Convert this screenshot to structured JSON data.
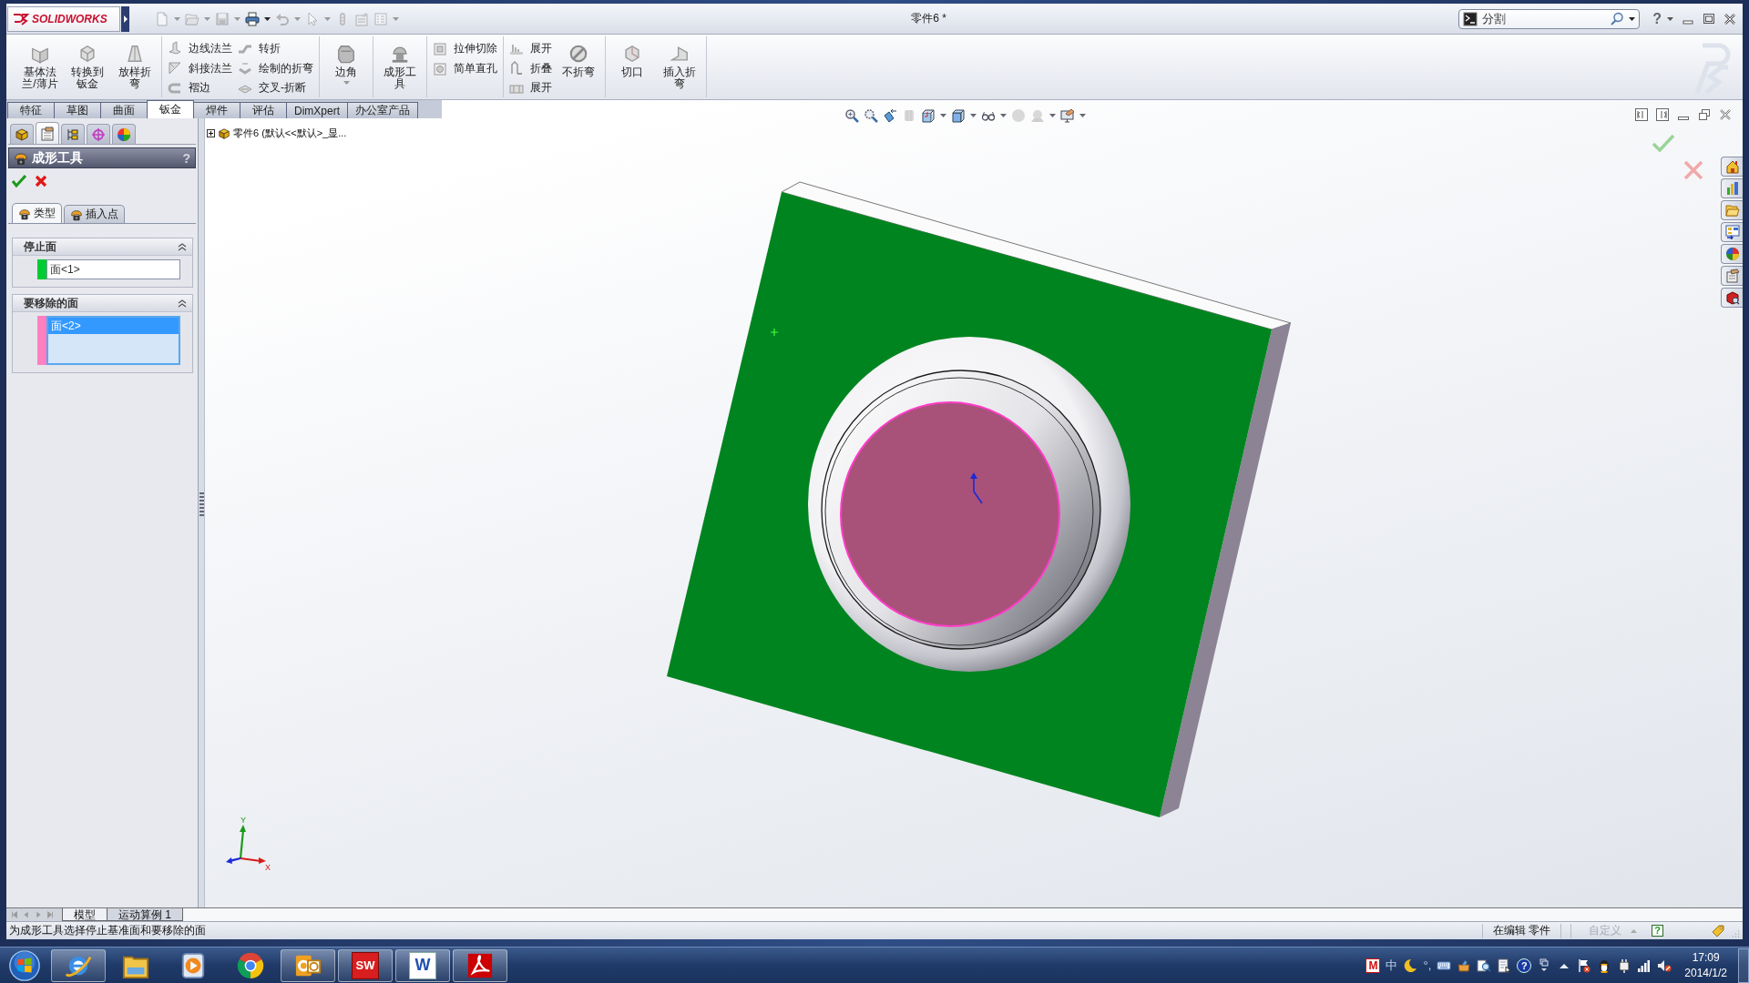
{
  "window": {
    "brand": "SOLIDWORKS",
    "title": "零件6 *",
    "search": {
      "value": "分割"
    },
    "help": "?"
  },
  "quick_access": [
    {
      "kind": "new",
      "menu": true,
      "disabled": true
    },
    {
      "kind": "open",
      "menu": true,
      "disabled": true
    },
    {
      "kind": "save",
      "menu": true,
      "disabled": true
    },
    {
      "kind": "print",
      "menu": true,
      "disabled": false
    },
    {
      "kind": "undo",
      "menu": true,
      "disabled": true
    },
    {
      "kind": "select",
      "menu": true,
      "disabled": true
    },
    {
      "kind": "rebuild",
      "menu": false,
      "disabled": true
    },
    {
      "kind": "properties",
      "menu": false,
      "disabled": true
    },
    {
      "kind": "options",
      "menu": true,
      "disabled": true
    }
  ],
  "ribbon": [
    [
      {
        "kind": "large",
        "label": "基体法兰/薄片",
        "menu": false
      },
      {
        "kind": "large",
        "label": "转换到钣金",
        "menu": false
      },
      {
        "kind": "large",
        "label": "放样折弯",
        "menu": false
      }
    ],
    [
      {
        "kind": "stack",
        "items": [
          {
            "label": "边线法兰"
          },
          {
            "label": "斜接法兰"
          },
          {
            "label": "褶边"
          }
        ]
      },
      {
        "kind": "stack",
        "items": [
          {
            "label": "转折"
          },
          {
            "label": "绘制的折弯"
          },
          {
            "label": "交叉-折断"
          }
        ]
      }
    ],
    [
      {
        "kind": "large",
        "label": "边角",
        "menu": true
      }
    ],
    [
      {
        "kind": "large",
        "label": "成形工具",
        "menu": false
      }
    ],
    [
      {
        "kind": "stack",
        "items": [
          {
            "label": "拉伸切除"
          },
          {
            "label": "简单直孔"
          }
        ]
      }
    ],
    [
      {
        "kind": "stack",
        "items": [
          {
            "label": "展开"
          },
          {
            "label": "折叠"
          },
          {
            "label": "展开"
          }
        ]
      },
      {
        "kind": "large",
        "label": "不折弯",
        "menu": false
      }
    ],
    [
      {
        "kind": "large",
        "label": "切口",
        "menu": false
      },
      {
        "kind": "large",
        "label": "插入折弯",
        "menu": false
      }
    ]
  ],
  "command_tabs": [
    {
      "label": "特征",
      "selected": false
    },
    {
      "label": "草图",
      "selected": false
    },
    {
      "label": "曲面",
      "selected": false
    },
    {
      "label": "钣金",
      "selected": true
    },
    {
      "label": "焊件",
      "selected": false
    },
    {
      "label": "评估",
      "selected": false
    },
    {
      "label": "DimXpert",
      "selected": false
    },
    {
      "label": "办公室产品",
      "selected": false
    }
  ],
  "manager_tabs": [
    {
      "kind": "feature-tree",
      "selected": false
    },
    {
      "kind": "property",
      "selected": true
    },
    {
      "kind": "configuration",
      "selected": false
    },
    {
      "kind": "dimxpert",
      "selected": false
    },
    {
      "kind": "display",
      "selected": false
    }
  ],
  "property_manager": {
    "title": "成形工具",
    "help": "?",
    "tabs": [
      {
        "label": "类型",
        "selected": true
      },
      {
        "label": "插入点",
        "selected": false
      }
    ],
    "groups": [
      {
        "title": "停止面",
        "kind": "field",
        "expanded": true,
        "color": "#00cc33",
        "items": [
          {
            "label": "面<1>",
            "selected": false
          }
        ]
      },
      {
        "title": "要移除的面",
        "kind": "list",
        "expanded": true,
        "color": "#ff80c0",
        "items": [
          {
            "label": "面<2>",
            "selected": true
          }
        ]
      }
    ]
  },
  "feature_tree": {
    "label": "零件6 (默认<<默认>_显...",
    "expanded": false
  },
  "heads_up_toolbar": [
    {
      "kind": "zoom-fit",
      "menu": false,
      "disabled": false
    },
    {
      "kind": "zoom-area",
      "menu": false,
      "disabled": false
    },
    {
      "kind": "previous-view",
      "menu": false,
      "disabled": false
    },
    {
      "kind": "section-view",
      "menu": false,
      "disabled": true
    },
    {
      "kind": "view-orientation",
      "menu": true,
      "disabled": false
    },
    {
      "kind": "display-style",
      "menu": true,
      "disabled": false
    },
    {
      "kind": "hide-show",
      "menu": true,
      "disabled": false
    },
    {
      "kind": "appearance",
      "menu": false,
      "disabled": true
    },
    {
      "kind": "scene",
      "menu": true,
      "disabled": true
    },
    {
      "kind": "view-settings",
      "menu": true,
      "disabled": false
    }
  ],
  "axis_labels": [
    "Y",
    "X"
  ],
  "task_pane": [
    {
      "kind": "home"
    },
    {
      "kind": "chart"
    },
    {
      "kind": "folder"
    },
    {
      "kind": "form"
    },
    {
      "kind": "globe"
    },
    {
      "kind": "clipboard"
    },
    {
      "kind": "box"
    }
  ],
  "bottom_tabs": [
    {
      "label": "模型",
      "selected": true
    },
    {
      "label": "运动算例 1",
      "selected": false
    }
  ],
  "status_bar": {
    "message": "为成形工具选择停止基准面和要移除的面",
    "mode": "在编辑 零件",
    "units": {
      "label": "自定义",
      "disabled": true
    },
    "help": "?"
  },
  "taskbar": {
    "apps": [
      {
        "kind": "ie",
        "running": true
      },
      {
        "kind": "explorer",
        "running": false
      },
      {
        "kind": "media",
        "running": false
      },
      {
        "kind": "chrome",
        "running": false
      },
      {
        "kind": "outlook",
        "running": true
      },
      {
        "kind": "solidworks",
        "label": "SW",
        "running": true
      },
      {
        "kind": "word",
        "label": "W",
        "running": true
      },
      {
        "kind": "acrobat",
        "running": true
      }
    ],
    "tray": [
      {
        "kind": "logo",
        "label": "M"
      },
      {
        "kind": "text",
        "label": "中"
      },
      {
        "kind": "moon"
      },
      {
        "kind": "text",
        "label": "°,"
      },
      {
        "kind": "keyboard"
      },
      {
        "kind": "toolbox"
      },
      {
        "kind": "search-doc"
      },
      {
        "kind": "document"
      },
      {
        "kind": "help",
        "label": "?"
      },
      {
        "kind": "window-menu"
      },
      {
        "kind": "show-hidden"
      },
      {
        "kind": "flag"
      },
      {
        "kind": "penguin"
      },
      {
        "kind": "plug"
      },
      {
        "kind": "signal"
      },
      {
        "kind": "speaker-muted"
      }
    ],
    "time": "17:09",
    "date": "2014/1/2"
  }
}
